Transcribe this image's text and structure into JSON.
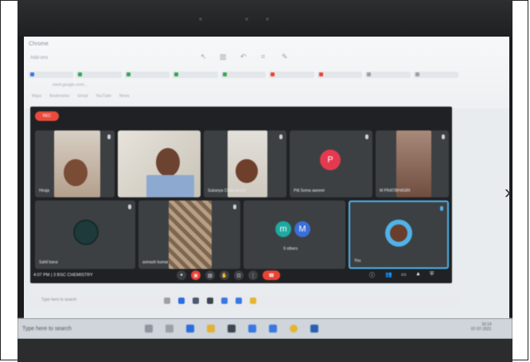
{
  "browser": {
    "title": "Chrome",
    "menu_label": "Add-ons",
    "url": "meet.google.com/...",
    "bookmarks": [
      "Maps",
      "Bookmarks",
      "Gmail",
      "YouTube",
      "News"
    ]
  },
  "meet": {
    "recording_badge": "REC",
    "participants": [
      {
        "name": "Hiraja",
        "kind": "video"
      },
      {
        "name": "",
        "kind": "video"
      },
      {
        "name": "Sukanya Chakraborty",
        "kind": "video"
      },
      {
        "name": "Pitt Soma awonei",
        "kind": "avatar",
        "initial": "P",
        "color": "#e53950"
      },
      {
        "name": "M PRATIBHASRI",
        "kind": "video"
      },
      {
        "name": "Sahil barui",
        "kind": "avatar",
        "initial": "",
        "color": "#1f3a3a"
      },
      {
        "name": "avinash kumar",
        "kind": "video"
      },
      {
        "name": "9 others",
        "kind": "group",
        "initials": [
          "m",
          "M"
        ],
        "colors": [
          "#1ea8a0",
          "#3a6fd8"
        ]
      },
      {
        "name": "You",
        "kind": "self"
      }
    ],
    "status_text": "4:07 PM | 3 BSC CHEMISTRY"
  },
  "taskbar": {
    "search_placeholder": "Type here to search",
    "lower_search_placeholder": "Type here to search",
    "clock_time": "16:14",
    "clock_date": "07-07-2021"
  },
  "colors": {
    "meet_bg": "#202124",
    "tile_bg": "#3c4043",
    "end_call": "#ea4335",
    "self_border": "#4fb3e8"
  }
}
